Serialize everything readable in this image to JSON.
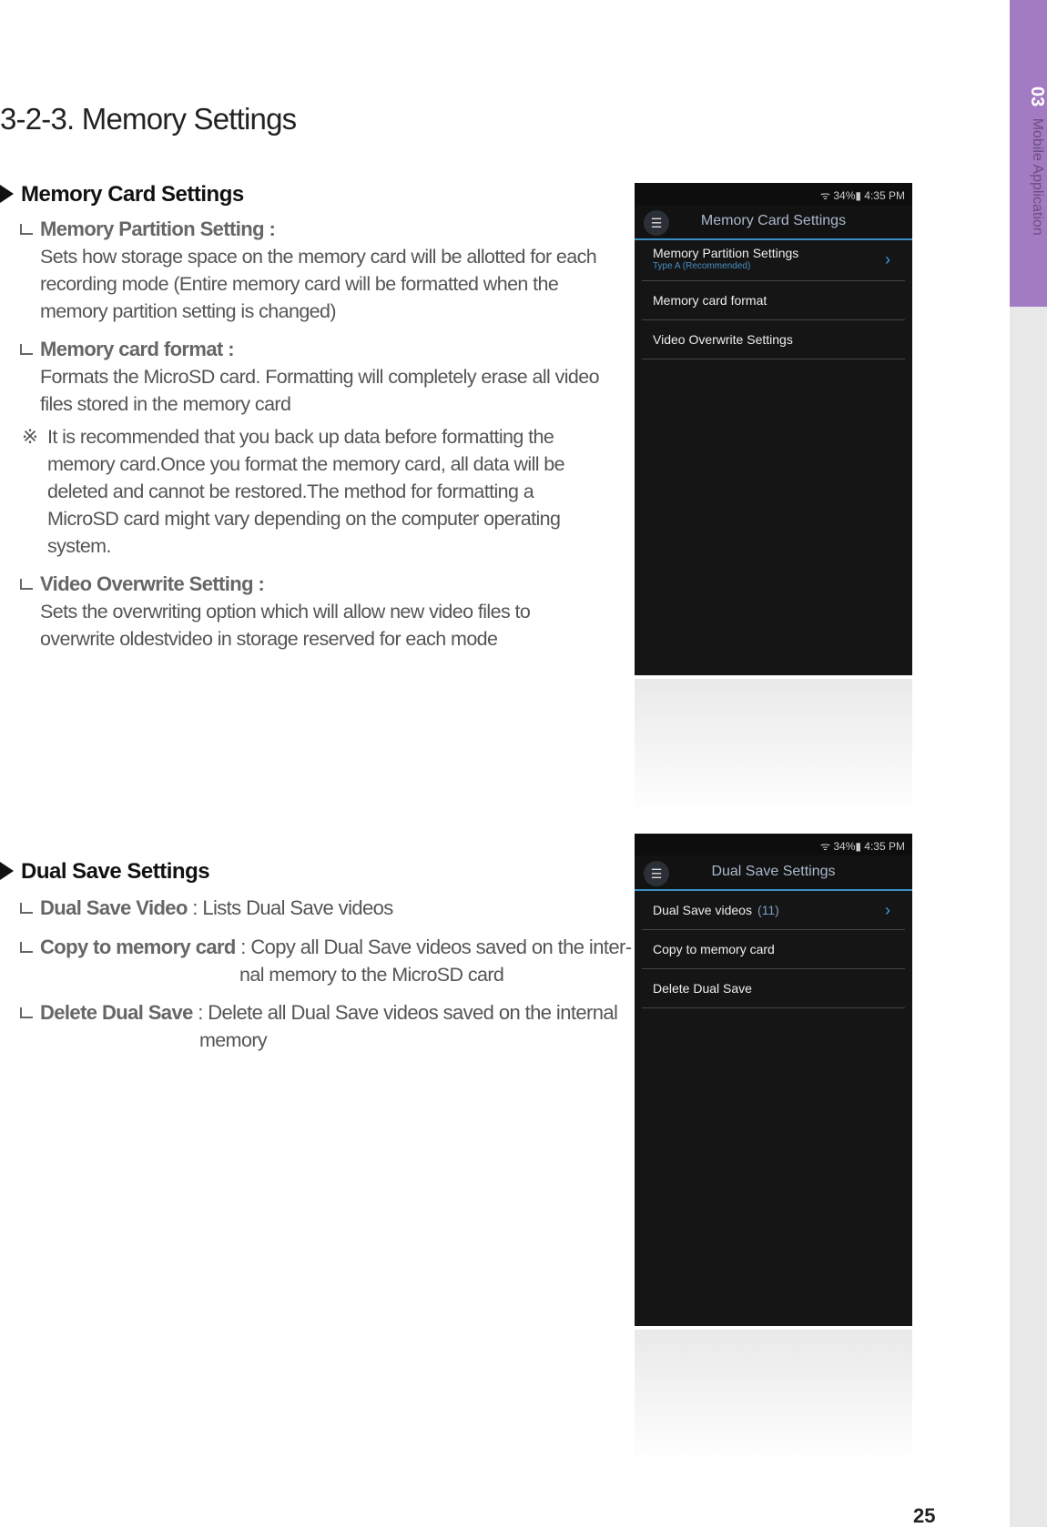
{
  "title": "3-2-3. Memory Settings",
  "side_tab": {
    "number": "03",
    "label": "Mobile Application",
    "color": "#a37bc2"
  },
  "page_number": "25",
  "memory": {
    "heading": "Memory Card Settings",
    "items": [
      {
        "label": "Memory Partition Setting :",
        "lines": [
          "Sets how storage space on the memory card will be allotted for each",
          "recording mode (Entire memory card will be formatted when the",
          "memory partition setting is changed)"
        ]
      },
      {
        "label": "Memory card format :",
        "lines": [
          "Formats the MicroSD card.  Formatting will completely erase all video",
          "files stored in the memory card"
        ]
      },
      {
        "label": "Video Overwrite Setting :",
        "lines": [
          "Sets the overwriting option which will allow new video files to",
          "overwrite oldestvideo in storage reserved for each mode"
        ]
      }
    ],
    "note": {
      "symbol": "※",
      "lines": [
        "It is recommended that you back up data before formatting the",
        "memory card.Once you format the memory card, all data will be",
        "deleted and cannot be restored.The method for formatting a",
        "MicroSD card might vary depending on the computer operating",
        "system."
      ]
    }
  },
  "dual": {
    "heading": "Dual Save Settings",
    "items": [
      {
        "label": "Dual Save Video",
        "desc": " : Lists Dual Save videos"
      },
      {
        "label": "Copy to memory card",
        "desc": " : Copy all Dual Save videos saved on the inter-",
        "cont": "nal memory to the MicroSD card"
      },
      {
        "label": "Delete Dual Save",
        "desc": " : Delete all Dual Save videos saved on the internal",
        "cont": "memory"
      }
    ]
  },
  "phone1": {
    "status": "34%▮ 4:35 PM",
    "title": "Memory Card Settings",
    "rows": [
      {
        "label": "Memory Partition Settings",
        "sub": "Type A (Recommended)"
      },
      {
        "label": "Memory card format"
      },
      {
        "label": "Video Overwrite Settings"
      }
    ]
  },
  "phone2": {
    "status": "34%▮ 4:35 PM",
    "title": "Dual Save Settings",
    "rows": [
      {
        "label": "Dual Save videos",
        "count": "(11)"
      },
      {
        "label": "Copy to memory card"
      },
      {
        "label": "Delete Dual Save"
      }
    ]
  }
}
